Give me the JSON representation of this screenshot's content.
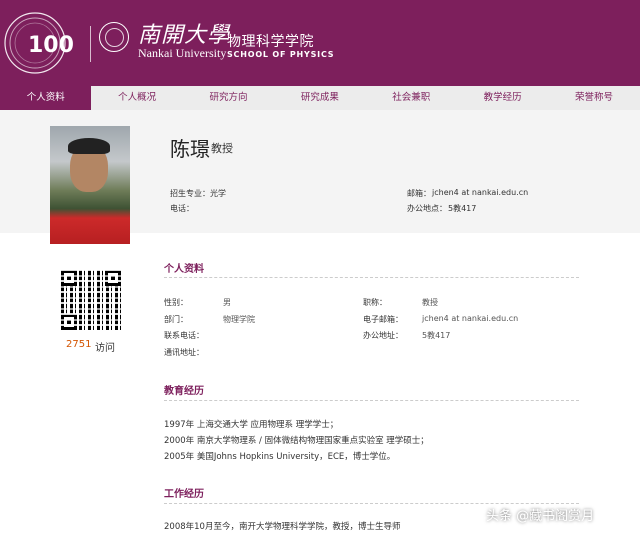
{
  "header": {
    "logo_text": "100",
    "university_cn": "南開大學",
    "university_en": "Nankai University",
    "school_cn": "物理科学学院",
    "school_en": "SCHOOL OF PHYSICS",
    "brand_color": "#7d1f5c"
  },
  "nav": {
    "items": [
      "个人资料",
      "个人概况",
      "研究方向",
      "研究成果",
      "社会兼职",
      "教学经历",
      "荣誉称号"
    ],
    "active_index": 0
  },
  "profile": {
    "name": "陈璟",
    "title": "教授",
    "major_label": "招生专业：",
    "major_value": "光学",
    "phone_label": "电话：",
    "email_label": "邮箱：",
    "email_value": "jchen4 at nankai.edu.cn",
    "office_label": "办公地点：",
    "office_value": "5教417"
  },
  "visits": {
    "count": "2751",
    "label": "访问"
  },
  "personal": {
    "title": "个人资料",
    "gender_label": "性别：",
    "gender_value": "男",
    "rank_label": "职称：",
    "rank_value": "教授",
    "dept_label": "部门：",
    "dept_value": "物理学院",
    "email_label": "电子邮箱：",
    "email_value": "jchen4 at nankai.edu.cn",
    "phone_label": "联系电话：",
    "office_label": "办公地址：",
    "office_value": "5教417",
    "address_label": "通讯地址："
  },
  "education": {
    "title": "教育经历",
    "lines": [
      "1997年 上海交通大学 应用物理系 理学学士；",
      "2000年 南京大学物理系 / 固体微结构物理国家重点实验室 理学硕士；",
      "2005年 美国Johns Hopkins University，ECE，博士学位。"
    ]
  },
  "work": {
    "title": "工作经历",
    "lines": [
      "2008年10月至今，南开大学物理科学学院，教授，博士生导师"
    ]
  },
  "watermark": "头条 @藏书阁赏月"
}
